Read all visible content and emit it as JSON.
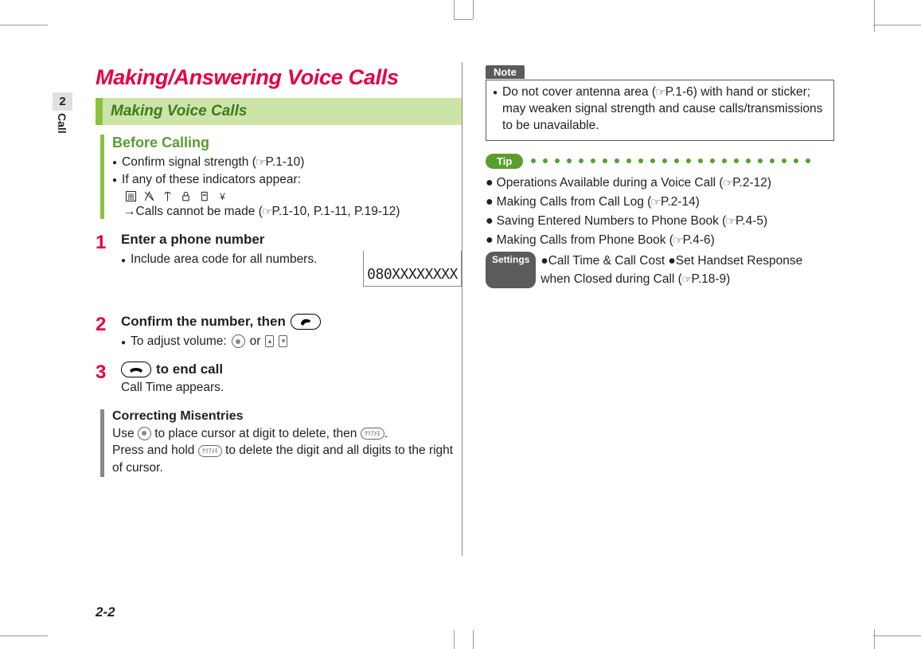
{
  "sidebar": {
    "chapter": "2",
    "label": "Call"
  },
  "title": "Making/Answering Voice Calls",
  "section": "Making Voice Calls",
  "before": {
    "heading": "Before Calling",
    "b1a": "Confirm signal strength (",
    "b1b": "P.1-10)",
    "b2": "If any of these indicators appear:",
    "arrow": "→",
    "arrowTextA": "Calls cannot be made (",
    "arrowTextB": "P.1-10, P.1-11, P.19-12)"
  },
  "step1": {
    "num": "1",
    "title": "Enter a phone number",
    "sub": "Include area code for all numbers.",
    "display": "080XXXXXXXX"
  },
  "step2": {
    "num": "2",
    "titleA": "Confirm the number, then",
    "subA": "To adjust volume:",
    "subOr": " or "
  },
  "step3": {
    "num": "3",
    "titleB": " to end call",
    "sub": "Call Time appears."
  },
  "misentries": {
    "heading": "Correcting Misentries",
    "l1a": "Use ",
    "l1b": " to place cursor at digit to delete, then ",
    "l1c": ".",
    "l2a": "Press and hold ",
    "l2b": " to delete the digit and all digits to the right of cursor."
  },
  "note": {
    "label": "Note",
    "textA": "Do not cover antenna area (",
    "textB": "P.1-6) with hand or sticker; may weaken signal strength and cause calls/transmissions to be unavailable."
  },
  "tip": {
    "label": "Tip",
    "t1a": "Operations Available during a Voice Call (",
    "t1b": "P.2-12)",
    "t2a": "Making Calls from Call Log (",
    "t2b": "P.2-14)",
    "t3a": "Saving Entered Numbers to Phone Book (",
    "t3b": "P.4-5)",
    "t4a": "Making Calls from Phone Book (",
    "t4b": "P.4-6)",
    "settingsLabel": "Settings",
    "s1": "●Call Time & Call Cost ●Set Handset Response when Closed during Call (",
    "s1b": "P.18-9)"
  },
  "pageNumber": "2-2",
  "keylabel": {
    "clear": "ｸﾘｱﾒﾓ"
  }
}
